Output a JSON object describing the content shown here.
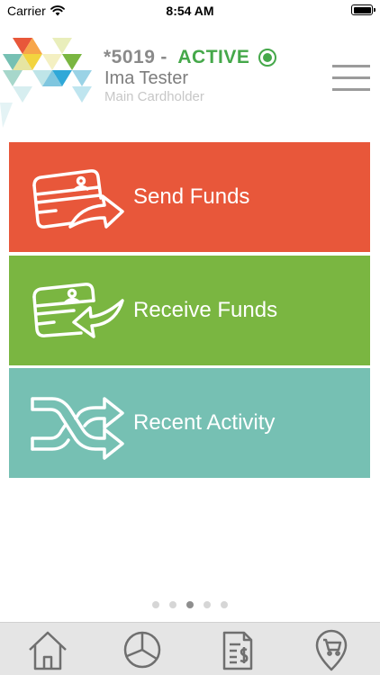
{
  "status_bar": {
    "carrier": "Carrier",
    "time": "8:54 AM",
    "wifi_icon": "wifi-icon",
    "battery_icon": "battery-icon"
  },
  "header": {
    "logo_icon": "triangle-mosaic-logo",
    "card_number": "*5019",
    "separator": "-",
    "card_status": "ACTIVE",
    "status_color": "#45a84a",
    "holder_name": "Ima Tester",
    "holder_role": "Main Cardholder",
    "menu_icon": "hamburger-menu-icon"
  },
  "tiles": [
    {
      "label": "Send Funds",
      "color": "#e8573a",
      "icon": "card-send-arrow-icon"
    },
    {
      "label": "Receive Funds",
      "color": "#7ab641",
      "icon": "card-receive-arrow-icon"
    },
    {
      "label": "Recent Activity",
      "color": "#76c0b3",
      "icon": "shuffle-arrows-icon"
    }
  ],
  "pager": {
    "count": 5,
    "active_index": 2
  },
  "tab_bar": {
    "background": "#e5e5e5",
    "icon_color": "#6f6f6f",
    "tabs": [
      {
        "icon": "home-icon"
      },
      {
        "icon": "pie-chart-icon"
      },
      {
        "icon": "statement-dollar-icon"
      },
      {
        "icon": "location-cart-icon"
      }
    ]
  }
}
